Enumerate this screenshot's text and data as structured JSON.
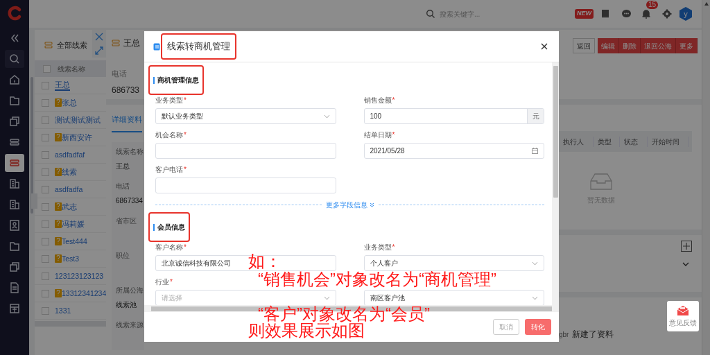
{
  "sidebar": {
    "items": [
      {
        "kind": "collapse",
        "selected": false
      },
      {
        "kind": "search",
        "selected": false
      },
      {
        "kind": "home",
        "selected": false
      },
      {
        "kind": "folder",
        "selected": false
      },
      {
        "kind": "copy",
        "selected": false
      },
      {
        "kind": "lead",
        "selected": false
      },
      {
        "kind": "lead",
        "selected": true
      },
      {
        "kind": "building",
        "selected": false
      },
      {
        "kind": "building",
        "selected": false
      },
      {
        "kind": "contact",
        "selected": false
      },
      {
        "kind": "folder",
        "selected": false
      },
      {
        "kind": "copy",
        "selected": false
      },
      {
        "kind": "document",
        "selected": false
      },
      {
        "kind": "grid",
        "selected": false
      }
    ]
  },
  "topbar": {
    "search": {
      "placeholder": "搜索关键字..."
    },
    "new_badge": "NEW",
    "notifications": "15",
    "avatar": "y"
  },
  "lead_list": {
    "filter": "全部线索",
    "column": "线索名称",
    "select_all_checked": false,
    "rows": [
      {
        "name": "王总",
        "badge": null,
        "checked": false,
        "selected": true
      },
      {
        "name": "张总",
        "badge": "?",
        "checked": false,
        "selected": false
      },
      {
        "name": "测试测试测试",
        "badge": null,
        "checked": false,
        "selected": false
      },
      {
        "name": "新西安许",
        "badge": "?",
        "checked": false,
        "selected": false
      },
      {
        "name": "asdfadfaf",
        "badge": null,
        "checked": false,
        "selected": false
      },
      {
        "name": "线索",
        "badge": "?",
        "checked": false,
        "selected": false
      },
      {
        "name": "asdfadfa",
        "badge": null,
        "checked": false,
        "selected": false
      },
      {
        "name": "武志",
        "badge": "?",
        "checked": false,
        "selected": false
      },
      {
        "name": "冯莉媛",
        "badge": "?",
        "checked": false,
        "selected": false
      },
      {
        "name": "Test444",
        "badge": "?",
        "checked": false,
        "selected": false
      },
      {
        "name": "Test3",
        "badge": "?",
        "checked": false,
        "selected": false
      },
      {
        "name": "123123123123",
        "badge": null,
        "checked": false,
        "selected": false
      },
      {
        "name": "13312341234",
        "badge": "?",
        "checked": false,
        "selected": false
      },
      {
        "name": "1331",
        "badge": null,
        "checked": false,
        "selected": false
      }
    ]
  },
  "detail": {
    "title": "王总",
    "phone_label": "电话",
    "phone": "686733",
    "tabs": [
      {
        "label": "详细资料",
        "selected": true
      }
    ],
    "fields": [
      {
        "label": "线索名称",
        "value": "王总"
      },
      {
        "label": "电话",
        "value": "6867334"
      },
      {
        "label": "省市区"
      },
      {
        "label": "职位"
      },
      {
        "label": "所属公海",
        "value": "线索池"
      },
      {
        "label": "线索来源"
      }
    ],
    "actions": [
      {
        "label": "返回",
        "kind": "plain"
      },
      {
        "label": "编辑",
        "kind": "danger"
      },
      {
        "label": "删除",
        "kind": "danger"
      },
      {
        "label": "退回公海",
        "kind": "danger"
      },
      {
        "label": "更多",
        "kind": "danger"
      }
    ],
    "task_table": {
      "columns": [
        "执行人",
        "类型",
        "状态",
        "开始时间"
      ],
      "empty": "暂无数据"
    },
    "activity": {
      "user": "gbr",
      "action": "新建了资料"
    }
  },
  "modal": {
    "title": "线索转商机管理",
    "title_highlighted": true,
    "sections": [
      {
        "title": "商机管理信息",
        "highlighted": true,
        "more_link": "更多字段信息",
        "fields": [
          {
            "label": "业务类型",
            "required": "*",
            "kind": "select",
            "value": "默认业务类型"
          },
          {
            "label": "销售金额",
            "required": "*",
            "kind": "amount",
            "value": "100",
            "suffix": "元"
          },
          {
            "label": "机会名称",
            "required": "*",
            "kind": "text"
          },
          {
            "label": "结单日期",
            "required": "*",
            "kind": "date",
            "value": "2021/05/28"
          },
          {
            "label": "客户电话",
            "required": "*",
            "kind": "text"
          }
        ]
      },
      {
        "title": "会员信息",
        "highlighted": true,
        "fields": [
          {
            "label": "客户名称",
            "required": "*",
            "kind": "text",
            "value": "北京诚信科技有限公司"
          },
          {
            "label": "业务类型",
            "required": "*",
            "kind": "select",
            "value": "个人客户"
          },
          {
            "label": "行业",
            "required": "*",
            "kind": "select",
            "placeholder": "请选择"
          },
          {
            "kind": "select",
            "value": "南区客户池"
          }
        ]
      }
    ],
    "buttons": [
      {
        "label": "取消",
        "kind": "cancel"
      },
      {
        "label": "转化",
        "kind": "primary"
      }
    ]
  },
  "annotation": {
    "lines": [
      "如：",
      "“销售机会”对象改名为“商机管理”",
      "“客户”对象改名为“会员”",
      "则效果展示如图"
    ]
  },
  "feedback": {
    "label": "意见反馈"
  }
}
